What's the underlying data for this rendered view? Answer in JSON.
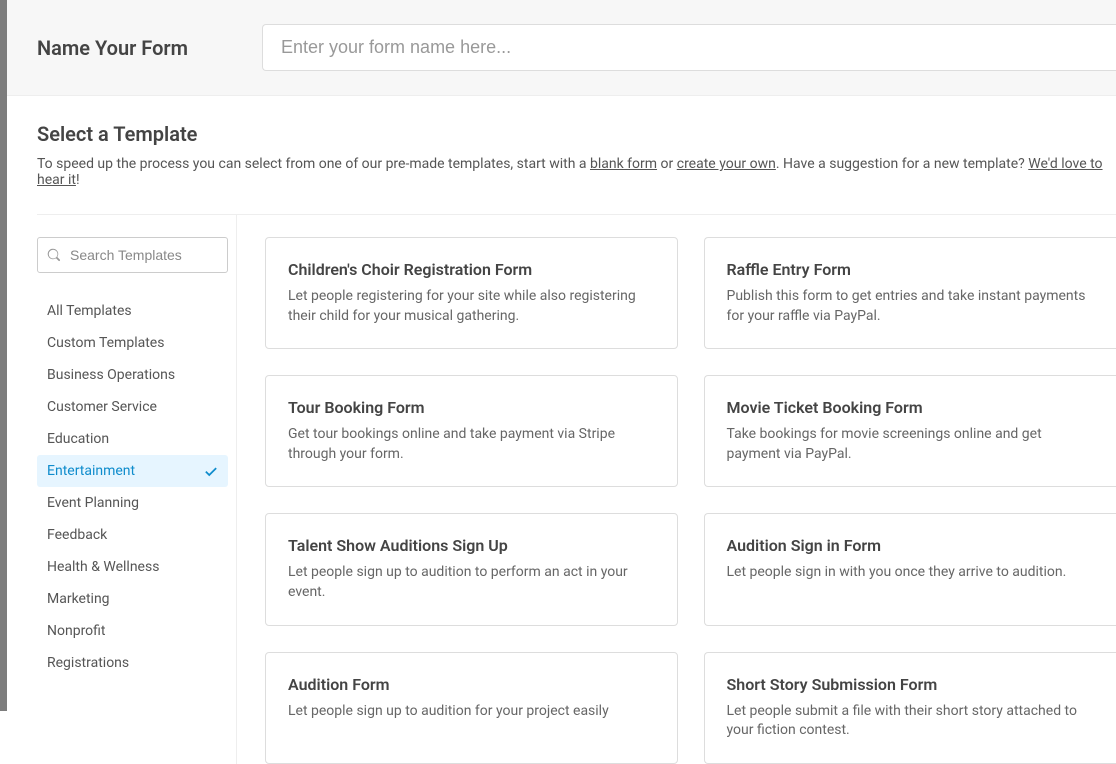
{
  "top": {
    "label": "Name Your Form",
    "placeholder": "Enter your form name here..."
  },
  "section": {
    "title": "Select a Template",
    "desc_pre": "To speed up the process you can select from one of our pre-made templates, start with a ",
    "link_blank": "blank form",
    "desc_or": " or ",
    "link_own": "create your own",
    "desc_mid": ". Have a suggestion for a new template? ",
    "link_hear": "We'd love to hear it",
    "desc_end": "!"
  },
  "sidebar": {
    "search_placeholder": "Search Templates",
    "categories": [
      {
        "label": "All Templates",
        "active": false
      },
      {
        "label": "Custom Templates",
        "active": false
      },
      {
        "label": "Business Operations",
        "active": false
      },
      {
        "label": "Customer Service",
        "active": false
      },
      {
        "label": "Education",
        "active": false
      },
      {
        "label": "Entertainment",
        "active": true
      },
      {
        "label": "Event Planning",
        "active": false
      },
      {
        "label": "Feedback",
        "active": false
      },
      {
        "label": "Health & Wellness",
        "active": false
      },
      {
        "label": "Marketing",
        "active": false
      },
      {
        "label": "Nonprofit",
        "active": false
      },
      {
        "label": "Registrations",
        "active": false
      }
    ]
  },
  "templates": [
    {
      "title": "Children's Choir Registration Form",
      "desc": "Let people registering for your site while also registering their child for your musical gathering."
    },
    {
      "title": "Raffle Entry Form",
      "desc": "Publish this form to get entries and take instant payments for your raffle via PayPal."
    },
    {
      "title": "Tour Booking Form",
      "desc": "Get tour bookings online and take payment via Stripe through your form."
    },
    {
      "title": "Movie Ticket Booking Form",
      "desc": "Take bookings for movie screenings online and get payment via PayPal."
    },
    {
      "title": "Talent Show Auditions Sign Up",
      "desc": "Let people sign up to audition to perform an act in your event."
    },
    {
      "title": "Audition Sign in Form",
      "desc": "Let people sign in with you once they arrive to audition."
    },
    {
      "title": "Audition Form",
      "desc": "Let people sign up to audition for your project easily"
    },
    {
      "title": "Short Story Submission Form",
      "desc": "Let people submit a file with their short story attached to your fiction contest."
    }
  ]
}
